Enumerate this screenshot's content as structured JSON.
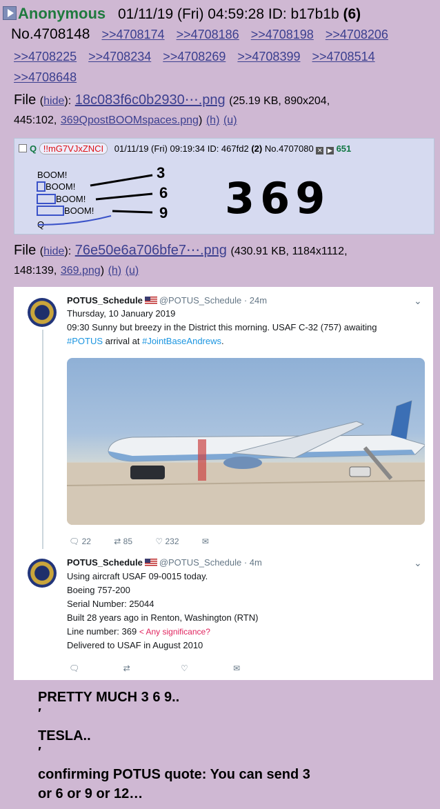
{
  "post": {
    "name": "Anonymous",
    "datetime": "01/11/19 (Fri) 04:59:28",
    "id_label": "ID: b17b1b",
    "id_count": "(6)",
    "number": "No.4708148",
    "replies": [
      ">>4708174",
      ">>4708186",
      ">>4708198",
      ">>4708206",
      ">>4708225",
      ">>4708234",
      ">>4708269",
      ">>4708399",
      ">>4708514",
      ">>4708648"
    ]
  },
  "file1": {
    "label": "File",
    "hide": "hide",
    "name": "18c083f6c0b2930⋯.png",
    "info": "(25.19 KB, 890x204,",
    "info2": "445:102,",
    "orig": "369QpostBOOMspaces.png",
    "h": "(h)",
    "u": "(u)"
  },
  "qpost": {
    "name": "Q",
    "trip": "!!mG7VJxZNCI",
    "datetime": "01/11/19 (Fri) 09:19:34",
    "id_label": "ID: 467fd2",
    "id_count": "(2)",
    "number": "No.4707080",
    "count": "651",
    "booms": [
      "BOOM!",
      "BOOM!",
      "BOOM!",
      "BOOM!"
    ],
    "q": "Q",
    "digits": [
      "3",
      "6",
      "9"
    ],
    "big": "369"
  },
  "file2": {
    "label": "File",
    "hide": "hide",
    "name": "76e50e6a706bfe7⋯.png",
    "info": "(430.91 KB, 1184x1112,",
    "info2": "148:139,",
    "orig": "369.png",
    "h": "(h)",
    "u": "(u)"
  },
  "tweet1": {
    "name": "POTUS_Schedule",
    "handle": "@POTUS_Schedule · 24m",
    "line1": "Thursday, 10 January 2019",
    "line2": "09:30 Sunny but breezy in the District this morning. USAF C-32 (757) awaiting",
    "hash1": "#POTUS",
    "mid": " arrival at ",
    "hash2": "#JointBaseAndrews",
    "end": ".",
    "replies": "22",
    "retweets": "85",
    "likes": "232"
  },
  "tweet2": {
    "name": "POTUS_Schedule",
    "handle": "@POTUS_Schedule · 4m",
    "lines": [
      "Using aircraft USAF 09-0015 today.",
      "Boeing 757-200",
      "Serial Number: 25044",
      "Built 28 years ago in Renton, Washington (RTN)",
      "Line number: 369",
      "Delivered to USAF in August 2010"
    ],
    "note": "< Any significance?"
  },
  "caption": {
    "l1": "PRETTY MUCH 3 6 9..",
    "tick": "′",
    "l2": "TESLA..",
    "l3": "confirming POTUS quote: You can send 3",
    "l4": "or 6 or 9 or 12…"
  },
  "colors": {
    "background": "#cfb8d3",
    "name": "#1f7a3e",
    "link": "#3b3f8f",
    "qpost": "#d6daf0",
    "box": "#3a52c8",
    "hashtag": "#1b95e0"
  }
}
